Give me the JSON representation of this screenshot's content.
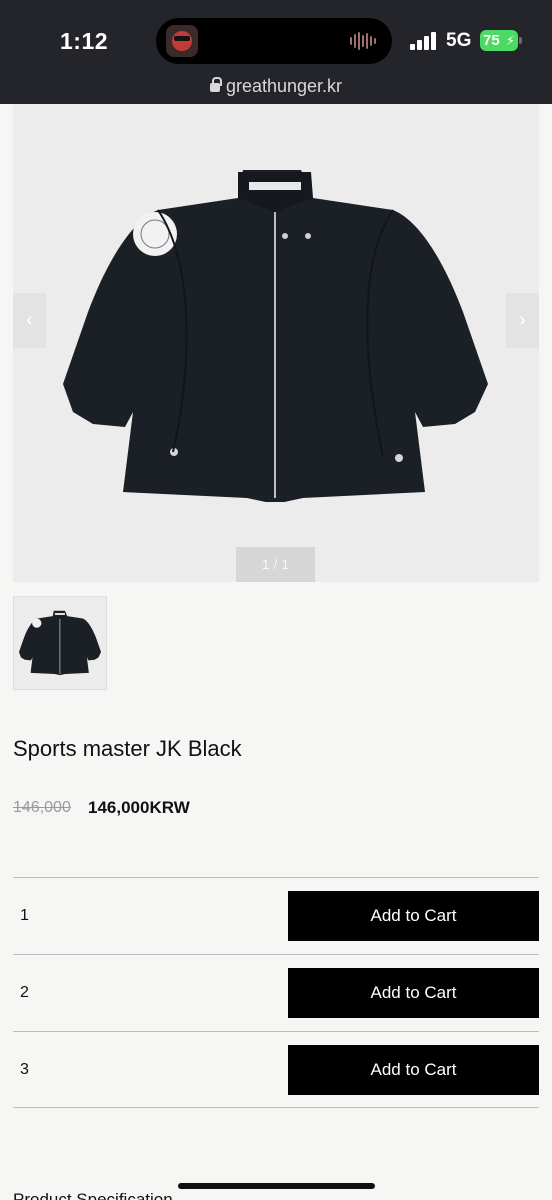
{
  "status_bar": {
    "time": "1:12",
    "network": "5G",
    "battery": "75",
    "url": "greathunger.kr"
  },
  "gallery": {
    "counter": "1 / 1",
    "prev_icon": "chevron-left-icon",
    "next_icon": "chevron-right-icon"
  },
  "product": {
    "name": "Sports master JK Black",
    "original_price": "146,000",
    "sale_price": "146,000KRW"
  },
  "options": [
    {
      "qty": "1",
      "button": "Add to Cart"
    },
    {
      "qty": "2",
      "button": "Add to Cart"
    },
    {
      "qty": "3",
      "button": "Add to Cart"
    }
  ],
  "footer": {
    "section_label": "Product Specification"
  },
  "colors": {
    "status_bar_bg": "#23252b",
    "button_bg": "#000000",
    "battery": "#4cd964"
  }
}
